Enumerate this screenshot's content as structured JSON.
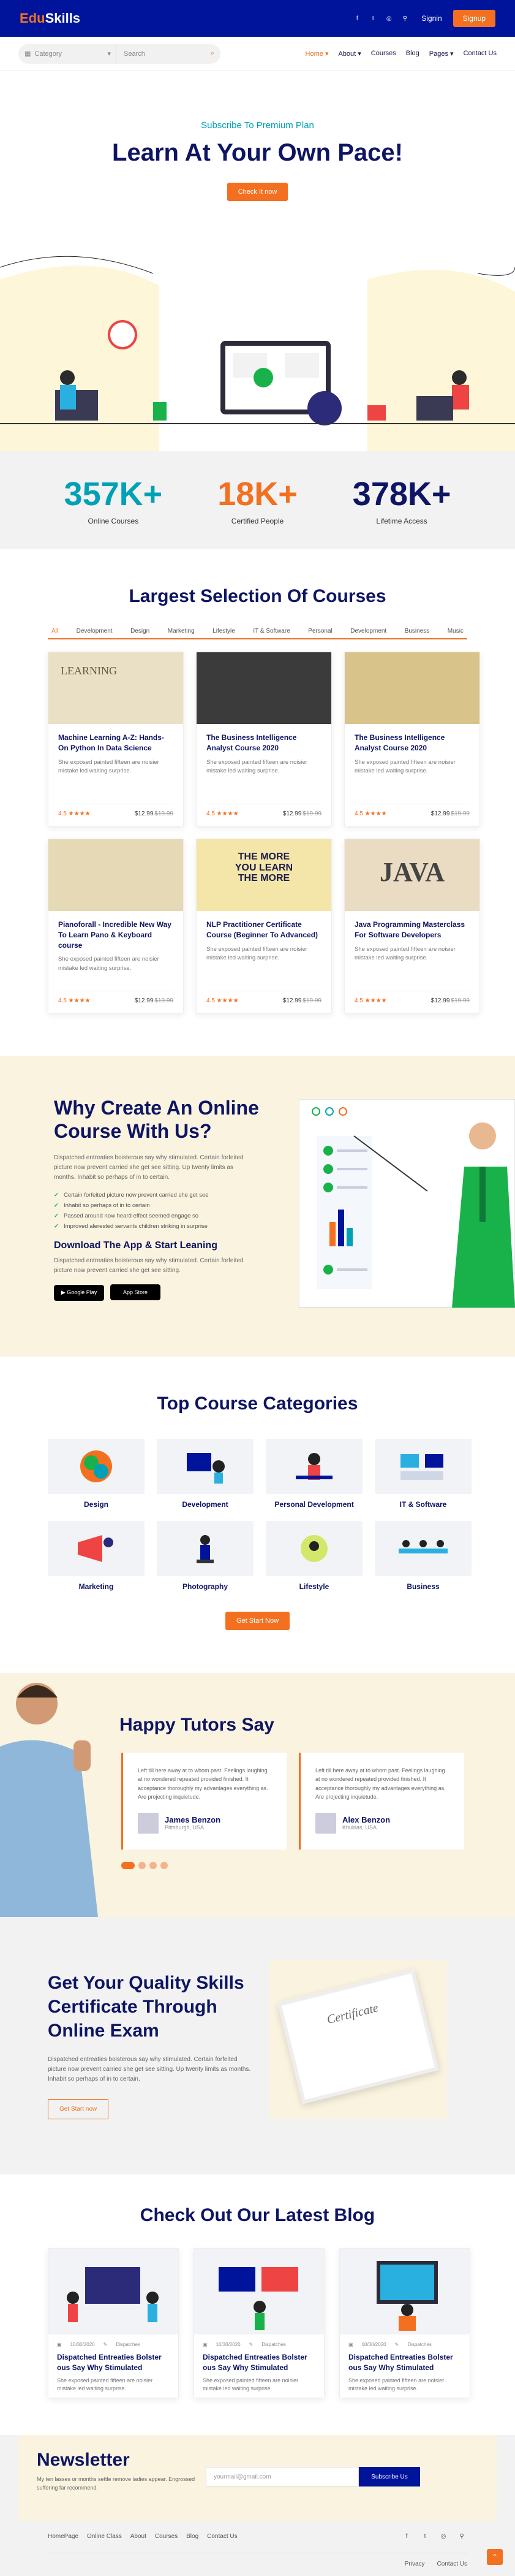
{
  "brand": {
    "logo_a": "Edu",
    "logo_b": "Skills"
  },
  "topbar": {
    "social": [
      "f",
      "t",
      "◎",
      "⚲"
    ],
    "signin": "Signin",
    "signup": "Signup"
  },
  "search": {
    "category": "Category",
    "placeholder": "Search"
  },
  "nav": [
    "Home ▾",
    "About ▾",
    "Courses",
    "Blog",
    "Pages ▾",
    "Contact Us"
  ],
  "hero": {
    "sub": "Subscribe To Premium Plan",
    "title": "Learn At Your Own Pace!",
    "cta": "Check It now"
  },
  "stats": [
    {
      "n": "357K+",
      "l": "Online Courses",
      "c": "#00a1b7"
    },
    {
      "n": "18K+",
      "l": "Certified People",
      "c": "#f37021"
    },
    {
      "n": "378K+",
      "l": "Lifetime Access",
      "c": "#0e1563"
    }
  ],
  "courses": {
    "title": "Largest Selection Of Courses",
    "tabs": [
      "All",
      "Development",
      "Design",
      "Marketing",
      "Lifestyle",
      "IT & Software",
      "Personal",
      "Development",
      "Business",
      "Music"
    ],
    "items": [
      {
        "t": "Machine Learning A-Z: Hands-On Python In Data Science",
        "d": "She exposed painted fifteen are noisier mistake led waiting surprise.",
        "r": "4.5 ★★★★",
        "p": "$12.99",
        "o": "$19.99",
        "img": "LEARNING"
      },
      {
        "t": "The Business Intelligence Analyst Course 2020",
        "d": "She exposed painted fifteen are noisier mistake led waiting surprise.",
        "r": "4.5 ★★★★",
        "p": "$12.99",
        "o": "$19.99",
        "img": ""
      },
      {
        "t": "The Business Intelligence Analyst Course 2020",
        "d": "She exposed painted fifteen are noisier mistake led waiting surprise.",
        "r": "4.5 ★★★★",
        "p": "$12.99",
        "o": "$19.99",
        "img": ""
      },
      {
        "t": "Pianoforall - Incredible New Way To Learn Pano & Keyboard course",
        "d": "She exposed painted fifteen are noisier mistake led waiting surprise.",
        "r": "4.5 ★★★★",
        "p": "$12.99",
        "o": "$19.99",
        "img": ""
      },
      {
        "t": "NLP Practitioner Certificate Course (Beginner To Advanced)",
        "d": "She exposed painted fifteen are noisier mistake led waiting surprise.",
        "r": "4.5 ★★★★",
        "p": "$12.99",
        "o": "$19.99",
        "img": "THE MORE YOU LEARN THE MORE"
      },
      {
        "t": "Java Programming Masterclass For Software Developers",
        "d": "She exposed painted fifteen are noisier mistake led waiting surprise.",
        "r": "4.5 ★★★★",
        "p": "$12.99",
        "o": "$19.99",
        "img": "JAVA"
      }
    ]
  },
  "why": {
    "title": "Why Create An Online Course With Us?",
    "p1": "Dispatched entreaties boisterous say why stimulated. Certain forfeited picture now prevent carried she get see sitting. Up twenty limits as months. Inhabit so perhaps of in to certain.",
    "list": [
      "Certain forfeited picture now prevent carried she get see",
      "Inhabit so perhaps of in to certain",
      "Passed around now heard effect seemed engage so",
      "Improved alerested servants children striking in surprise"
    ],
    "h3": "Download The App & Start Leaning",
    "p2": "Dispatched entreaties boisterous say why stimulated. Certain forfeited picture now prevent carried she get see sitting.",
    "stores": [
      "▶ Google Play",
      " App Store"
    ]
  },
  "cats": {
    "title": "Top Course Categories",
    "items": [
      "Design",
      "Development",
      "Personal Development",
      "IT & Software",
      "Marketing",
      "Photography",
      "Lifestyle",
      "Business"
    ],
    "cta": "Get Start Now"
  },
  "tutors": {
    "title": "Happy Tutors Say",
    "cards": [
      {
        "q": "Left till here away at to whom past. Feelings laughing at no wondered repeated provided finished. It acceptance thoroughly my advantages everything as. Are projecting inquietude.",
        "n": "James Benzon",
        "l": "Pittsburgh, USA"
      },
      {
        "q": "Left till here away at to whom past. Feelings laughing at no wondered repeated provided finished. It acceptance thoroughly my advantages everything as. Are projecting inquietude.",
        "n": "Alex Benzon",
        "l": "Khulnas, USA"
      }
    ]
  },
  "cert": {
    "title": "Get Your Quality Skills Certificate Through Online Exam",
    "p": "Dispatched entreaties boisterous say why stimulated. Certain forfeited picture now prevent carried she get see sitting. Up twenty limits as months. Inhabit so perhaps of in to certain.",
    "cta": "Get Start now",
    "paper": "Certificate"
  },
  "blog": {
    "title": "Check Out Our Latest Blog",
    "items": [
      {
        "date": "10/30/2020",
        "tag": "Dispatches",
        "t": "Dispatched Entreaties Bolster ous Say Why Stimulated",
        "d": "She exposed painted fifteen are noisier mistake led waiting surprise."
      },
      {
        "date": "10/30/2020",
        "tag": "Dispatches",
        "t": "Dispatched Entreaties Bolster ous Say Why Stimulated",
        "d": "She exposed painted fifteen are noisier mistake led waiting surprise."
      },
      {
        "date": "10/30/2020",
        "tag": "Dispatches",
        "t": "Dispatched Entreaties Bolster ous Say Why Stimulated",
        "d": "She exposed painted fifteen are noisier mistake led waiting surprise."
      }
    ]
  },
  "news": {
    "title": "Newsletter",
    "p": "My ten lasses or months settle remove ladies appear. Engrossed suffering far recommend.",
    "placeholder": "yourmail@gmail.com",
    "btn": "Subscribe Us"
  },
  "footer": {
    "links": [
      "HomePage",
      "Online Class",
      "About",
      "Courses",
      "Blog",
      "Contact Us"
    ],
    "social": [
      "f",
      "t",
      "◎",
      "⚲"
    ],
    "bottom": [
      "Privacy",
      "Contact Us"
    ],
    "top": "⌃"
  }
}
